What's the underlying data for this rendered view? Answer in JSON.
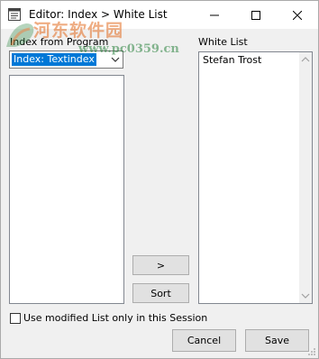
{
  "window": {
    "title": "Editor: Index > White List",
    "controls": {
      "minimize_icon": "minimize-icon",
      "maximize_icon": "maximize-icon",
      "close_icon": "close-icon"
    }
  },
  "watermark": {
    "text_cn": "河东软件园",
    "url": "www.pc0359.cn"
  },
  "left_panel": {
    "label": "Index from Program",
    "combo": {
      "selected": "Index: Textindex"
    },
    "items": []
  },
  "right_panel": {
    "label": "White List",
    "items": [
      "Stefan Trost"
    ]
  },
  "buttons": {
    "move_label": ">",
    "sort_label": "Sort",
    "cancel_label": "Cancel",
    "save_label": "Save"
  },
  "session_option": {
    "label": "Use modified List only in this Session",
    "checked": false
  },
  "colors": {
    "selection": "#0078d7",
    "window_bg": "#f0f0f0",
    "watermark_cn": "#e1691e",
    "watermark_url": "#28823c"
  }
}
